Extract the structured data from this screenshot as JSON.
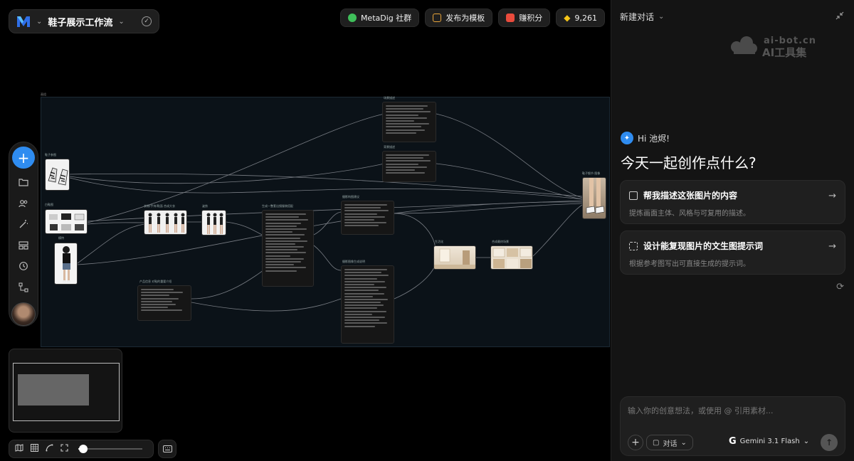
{
  "project": {
    "title": "鞋子展示工作流"
  },
  "toolbar": {
    "community_label": "MetaDig 社群",
    "publish_label": "发布为模板",
    "earn_label": "赚积分",
    "points_value": "9,261",
    "colors": {
      "community": "#3fbf5a",
      "publish": "#e9a53a",
      "earn": "#e94b3c",
      "points": "#f5c518"
    }
  },
  "canvas": {
    "group_label": "画组",
    "nodes": [
      {
        "id": "shoe-ref",
        "label": "鞋子参图"
      },
      {
        "id": "outfit",
        "label": "白鞋图"
      },
      {
        "id": "model",
        "label": "模特"
      },
      {
        "id": "outfit-set",
        "label": "衣物/手持/鞋面 合成大衣"
      },
      {
        "id": "pose",
        "label": "姿势"
      },
      {
        "id": "prompt-main",
        "label": "生成一整套出镜服装搭配"
      },
      {
        "id": "scene-desc",
        "label": "场景描述"
      },
      {
        "id": "bg-desc",
        "label": "背景描述"
      },
      {
        "id": "shot-advice",
        "label": "摄影构图建议"
      },
      {
        "id": "product-info",
        "label": "产品信息 对鞋的重要介绍"
      },
      {
        "id": "shot-desc",
        "label": "摄影图像生成说明"
      },
      {
        "id": "lifestyle",
        "label": "生活化"
      },
      {
        "id": "final-scene",
        "label": "合成最终场景"
      },
      {
        "id": "final-out",
        "label": "鞋子细节 图像"
      }
    ]
  },
  "chat": {
    "new_chat_label": "新建对话",
    "watermark_line1": "ai-bot.cn",
    "watermark_line2": "AI工具集",
    "greeting": "Hi 池烬!",
    "headline": "今天一起创作点什么?",
    "suggestions": [
      {
        "title": "帮我描述这张图片的内容",
        "desc": "提炼画面主体、风格与可复用的描述。",
        "icon": "image-icon"
      },
      {
        "title": "设计能复现图片的文生图提示词",
        "desc": "根据参考图写出可直接生成的提示词。",
        "icon": "scan-icon"
      }
    ],
    "input_placeholder": "输入你的创意想法，或使用 @ 引用素材...",
    "mode_label": "对话",
    "model_label": "Gemini 3.1 Flash"
  },
  "zoom": {
    "level": 0.08
  }
}
